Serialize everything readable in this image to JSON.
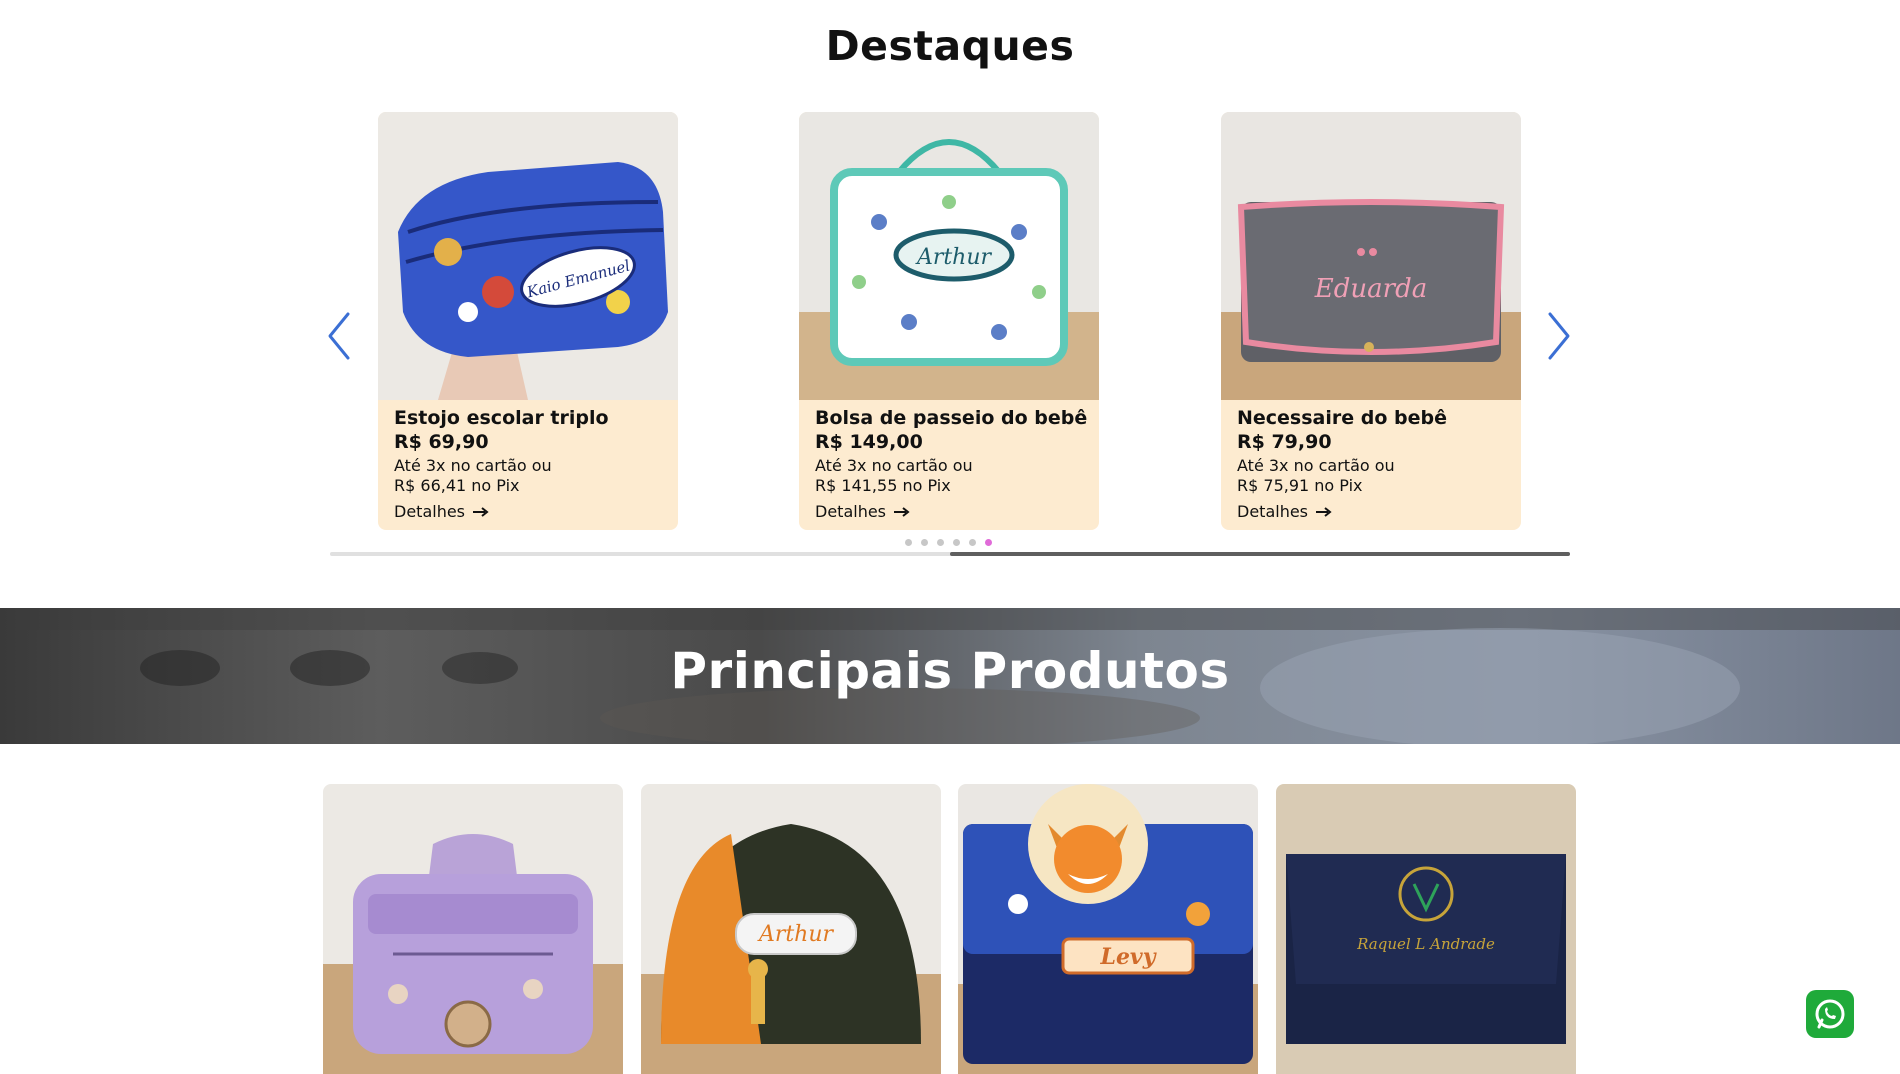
{
  "destaques": {
    "title": "Destaques",
    "cards": [
      {
        "name": "Estojo escolar triplo",
        "price": "R$ 69,90",
        "installments": "Até 3x no cartão ou",
        "pix": "R$ 66,41 no Pix",
        "details": "Detalhes",
        "embroidery": "Kaio Emanuel"
      },
      {
        "name": "Bolsa de passeio do bebê",
        "price": "R$ 149,00",
        "installments": "Até 3x no cartão ou",
        "pix": "R$ 141,55 no Pix",
        "details": "Detalhes",
        "embroidery": "Arthur"
      },
      {
        "name": "Necessaire do bebê",
        "price": "R$ 79,90",
        "installments": "Até 3x no cartão ou",
        "pix": "R$ 75,91 no Pix",
        "details": "Detalhes",
        "embroidery": "Eduarda"
      }
    ],
    "pagination": {
      "count": 6,
      "active_index": 5
    },
    "scroll_progress": 1.0
  },
  "principais": {
    "title": "Principais Produtos",
    "products": [
      {
        "embroidery": ""
      },
      {
        "embroidery": "Arthur"
      },
      {
        "embroidery": "Levy"
      },
      {
        "embroidery": "Raquel L Andrade"
      }
    ]
  },
  "colors": {
    "card_bg": "#fdebd0",
    "arrow": "#3b6fd4",
    "dot_active": "#e06bd8",
    "whatsapp": "#1faa3a"
  },
  "icons": {
    "prev": "chevron-left-icon",
    "next": "chevron-right-icon",
    "details": "arrow-right-icon",
    "whatsapp": "whatsapp-icon"
  }
}
